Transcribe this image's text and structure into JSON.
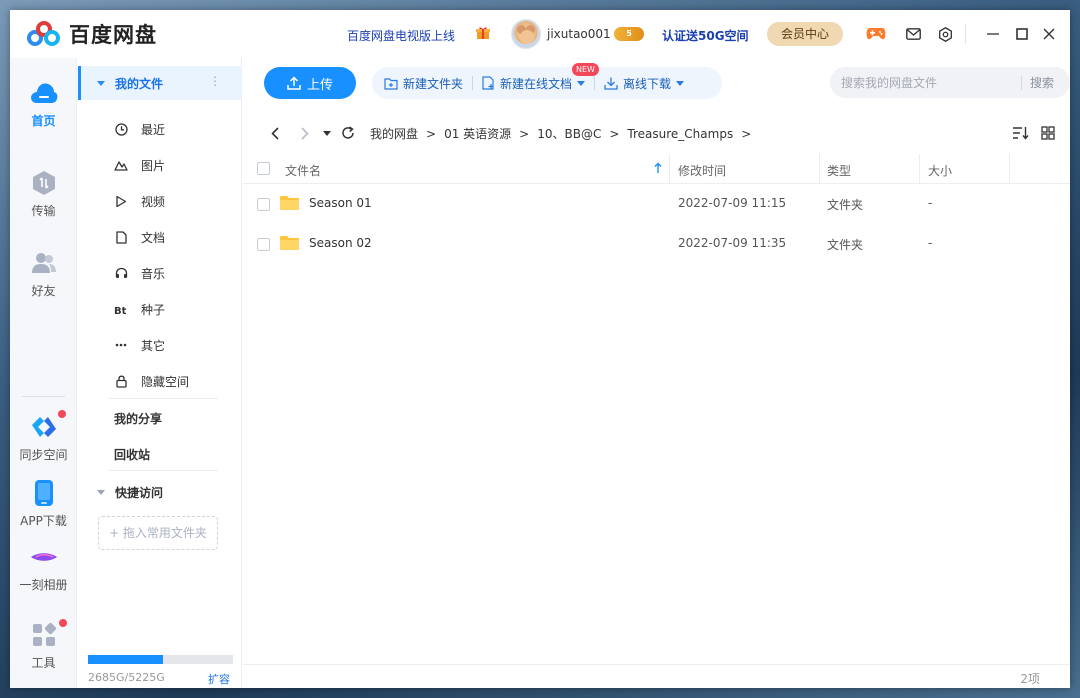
{
  "app": {
    "title": "百度网盘",
    "tv_link": "百度网盘电视版上线",
    "username": "jixutao001",
    "level_badge": "5",
    "promo": "认证送50G空间",
    "vip_button": "会员中心"
  },
  "rail": {
    "home": "首页",
    "transfer": "传输",
    "friends": "好友",
    "sync": "同步空间",
    "app_download": "APP下载",
    "album": "一刻相册",
    "tools": "工具"
  },
  "nav": {
    "my_files": "我的文件",
    "more": "⋮",
    "items": [
      {
        "label": "最近",
        "icon": "clock-icon"
      },
      {
        "label": "图片",
        "icon": "image-icon"
      },
      {
        "label": "视频",
        "icon": "play-icon"
      },
      {
        "label": "文档",
        "icon": "document-icon"
      },
      {
        "label": "音乐",
        "icon": "headphones-icon"
      },
      {
        "label": "种子",
        "icon": "torrent-icon"
      },
      {
        "label": "其它",
        "icon": "dots-icon"
      },
      {
        "label": "隐藏空间",
        "icon": "lock-icon"
      }
    ],
    "my_share": "我的分享",
    "recycle_bin": "回收站",
    "quick_access": "快捷访问",
    "drop_hint": "+ 拖入常用文件夹",
    "storage_text": "2685G/5225G",
    "storage_fraction": 0.514,
    "expand": "扩容"
  },
  "toolbar": {
    "upload": "上传",
    "new_folder": "新建文件夹",
    "new_online_doc": "新建在线文档",
    "new_tag": "NEW",
    "offline_download": "离线下载",
    "search_placeholder": "搜索我的网盘文件",
    "search_button": "搜索"
  },
  "breadcrumb": [
    "我的网盘",
    "01 英语资源",
    "10、BB@C",
    "Treasure_Champs"
  ],
  "table": {
    "headers": {
      "name": "文件名",
      "modified": "修改时间",
      "type": "类型",
      "size": "大小"
    },
    "rows": [
      {
        "name": "Season 01",
        "modified": "2022-07-09 11:15",
        "type": "文件夹",
        "size": "-"
      },
      {
        "name": "Season 02",
        "modified": "2022-07-09 11:35",
        "type": "文件夹",
        "size": "-"
      }
    ]
  },
  "status": {
    "count": "2项"
  },
  "colors": {
    "accent": "#1890ff",
    "folder": "#ffc53d",
    "badge": "#f5475a"
  }
}
